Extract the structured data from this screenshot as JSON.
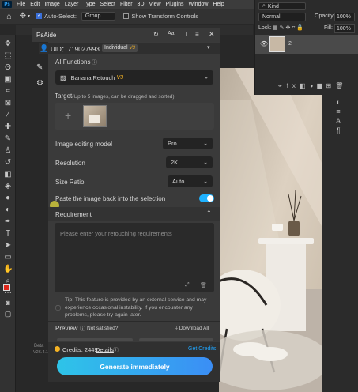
{
  "menubar": {
    "logo": "Ps",
    "items": [
      "File",
      "Edit",
      "Image",
      "Layer",
      "Type",
      "Select",
      "Filter",
      "3D",
      "View",
      "Plugins",
      "Window",
      "Help"
    ]
  },
  "optionsbar": {
    "auto_select_label": "Auto-Select:",
    "group_value": "Group",
    "show_transform_label": "Show Transform Controls"
  },
  "layers_panel": {
    "kind_label": "Kind",
    "blend_mode": "Normal",
    "opacity_label": "Opacity:",
    "opacity_value": "100%",
    "lock_label": "Lock:",
    "fill_label": "Fill:",
    "fill_value": "100%",
    "layer_name": "2"
  },
  "plugin": {
    "title": "PsAide",
    "uid_label": "UID：719027993",
    "plan_badge": "Individual",
    "ai_functions_label": "AI Functions",
    "function_value": "Banana Retouch",
    "function_badge": "V3",
    "target_label": "Target",
    "target_hint": "(Up to 5 images, can be dragged and sorted)",
    "model_label": "Image editing model",
    "model_value": "Pro",
    "resolution_label": "Resolution",
    "resolution_value": "2K",
    "size_ratio_label": "Size Ratio",
    "size_ratio_value": "Auto",
    "paste_back_label": "Paste the image back into the selection",
    "paste_back_enabled": true,
    "requirement_label": "Requirement",
    "requirement_placeholder": "Please enter your retouching requirements",
    "tip_text": "Tip: This feature is provided by an external service and may experience occasional instability. If you encounter any problems, please try again later.",
    "preview_label": "Preview",
    "not_satisfied_label": "Not satisfied?",
    "download_all_label": "Download All",
    "credits_label": "Credits: 2449",
    "details_label": "Details",
    "get_credits_label": "Get Credits",
    "generate_label": "Generate immediately",
    "version_text": "V26.4.1",
    "beta_text": "Beta"
  },
  "colors": {
    "accent": "#1fb2ff",
    "generate_start": "#2ec4e8",
    "generate_end": "#3b8ef5",
    "credits_coin": "#f5b324",
    "foreground_swatch": "#e0271b"
  }
}
